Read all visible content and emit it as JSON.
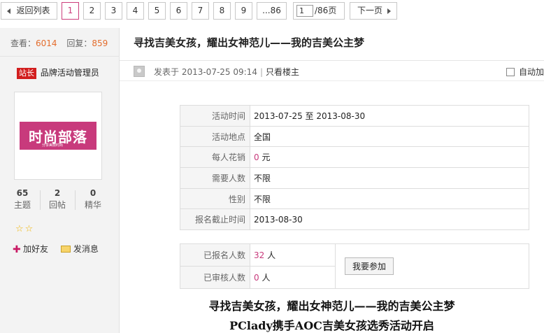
{
  "pager": {
    "back_label": "返回列表",
    "pages": [
      "1",
      "2",
      "3",
      "4",
      "5",
      "6",
      "7",
      "8",
      "9"
    ],
    "current_page": "1",
    "last_label": "...86",
    "jump_value": "1",
    "jump_suffix": "/86页",
    "next_label": "下一页"
  },
  "stats": {
    "views_label": "查看：",
    "views": "6014",
    "replies_label": "回复：",
    "replies": "859"
  },
  "author": {
    "badge": "站长",
    "name": "品牌活动管理员",
    "avatar_logo": "时尚部落",
    "avatar_tagline": "分享美丽时尚",
    "counts": [
      {
        "value": "65",
        "label": "主题"
      },
      {
        "value": "2",
        "label": "回帖"
      },
      {
        "value": "0",
        "label": "精华"
      }
    ],
    "stars": [
      "☆",
      "☆"
    ],
    "add_friend": "加好友",
    "send_message": "发消息"
  },
  "thread": {
    "title": "寻找吉美女孩，耀出女神范儿——我的吉美公主梦",
    "posted_at": "发表于 2013-07-25 09:14",
    "only_op": "只看楼主",
    "autoplay": "自动加"
  },
  "activity": {
    "rows": [
      {
        "key": "活动时间",
        "value": "2013-07-25 至 2013-08-30"
      },
      {
        "key": "活动地点",
        "value": "全国"
      },
      {
        "key": "每人花销",
        "value_num": "0",
        "value_unit": " 元"
      },
      {
        "key": "需要人数",
        "value": "不限"
      },
      {
        "key": "性别",
        "value": "不限"
      },
      {
        "key": "报名截止时间",
        "value": "2013-08-30"
      }
    ]
  },
  "signup": {
    "registered_label": "已报名人数",
    "registered_num": "32",
    "registered_unit": " 人",
    "approved_label": "已审核人数",
    "approved_num": "0",
    "approved_unit": " 人",
    "join_button": "我要参加"
  },
  "content": {
    "heading": "寻找吉美女孩，耀出女神范儿——我的吉美公主梦",
    "subheading": "PClady携手AOC吉美女孩选秀活动开启"
  },
  "colors": {
    "accent": "#cc3e7c",
    "count_orange": "#e36d2d",
    "badge_red": "#d21e1e"
  }
}
